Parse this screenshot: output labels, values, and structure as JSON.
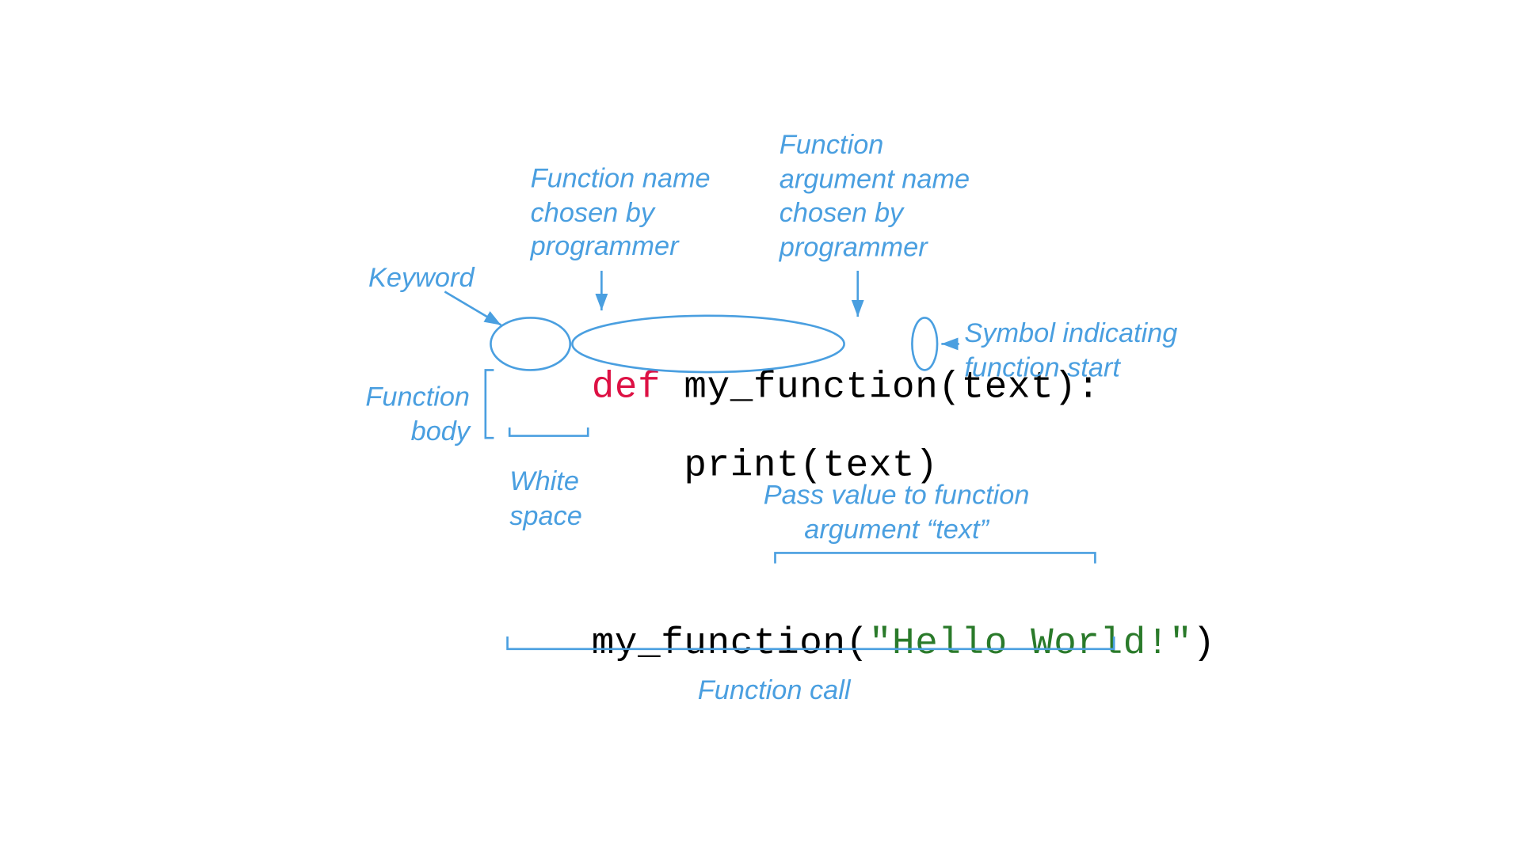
{
  "labels": {
    "keyword": "Keyword",
    "func_name_line1": "Function name",
    "func_name_line2": "chosen by",
    "func_name_line3": "programmer",
    "arg_name_line1": "Function",
    "arg_name_line2": "argument name",
    "arg_name_line3": "chosen by",
    "arg_name_line4": "programmer",
    "symbol_line1": "Symbol indicating",
    "symbol_line2": "function start",
    "body_line1": "Function",
    "body_line2": "body",
    "white_line1": "White",
    "white_line2": "space",
    "pass_line1": "Pass value to function",
    "pass_line2": "argument “text”",
    "call": "Function call"
  },
  "code": {
    "kw_def": "def",
    "func_name": "my_function",
    "arg": "text",
    "colon": ":",
    "print_call": "print(text)",
    "call_prefix": "my_function(",
    "call_string": "\"Hello World!\"",
    "call_suffix": ")"
  },
  "colors": {
    "annotation": "#4a9fe0",
    "keyword": "#d14",
    "string": "#2a7a2a",
    "text": "#000000"
  }
}
